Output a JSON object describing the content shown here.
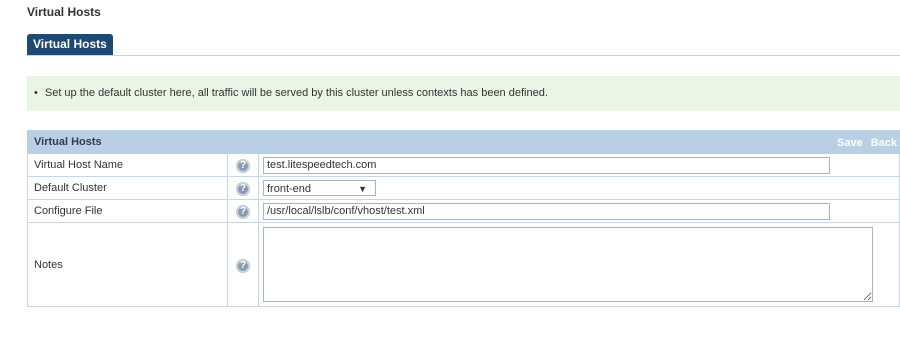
{
  "page": {
    "title": "Virtual Hosts"
  },
  "tabs": [
    {
      "label": "Virtual Hosts",
      "active": true
    }
  ],
  "info": {
    "text": "Set up the default cluster here, all traffic will be served by this cluster unless contexts has been defined."
  },
  "table": {
    "title": "Virtual Hosts",
    "actions": {
      "save": "Save",
      "back": "Back"
    },
    "rows": [
      {
        "label": "Virtual Host Name",
        "value": "test.litespeedtech.com"
      },
      {
        "label": "Default Cluster",
        "value": "front-end"
      },
      {
        "label": "Configure File",
        "value": "/usr/local/lslb/conf/vhost/test.xml"
      },
      {
        "label": "Notes",
        "value": ""
      }
    ],
    "help_icon": "question-mark-icon"
  },
  "colors": {
    "tab_bg": "#1d4a74",
    "header_bg": "#b8cfe5",
    "info_bg": "#eaf5e6"
  }
}
